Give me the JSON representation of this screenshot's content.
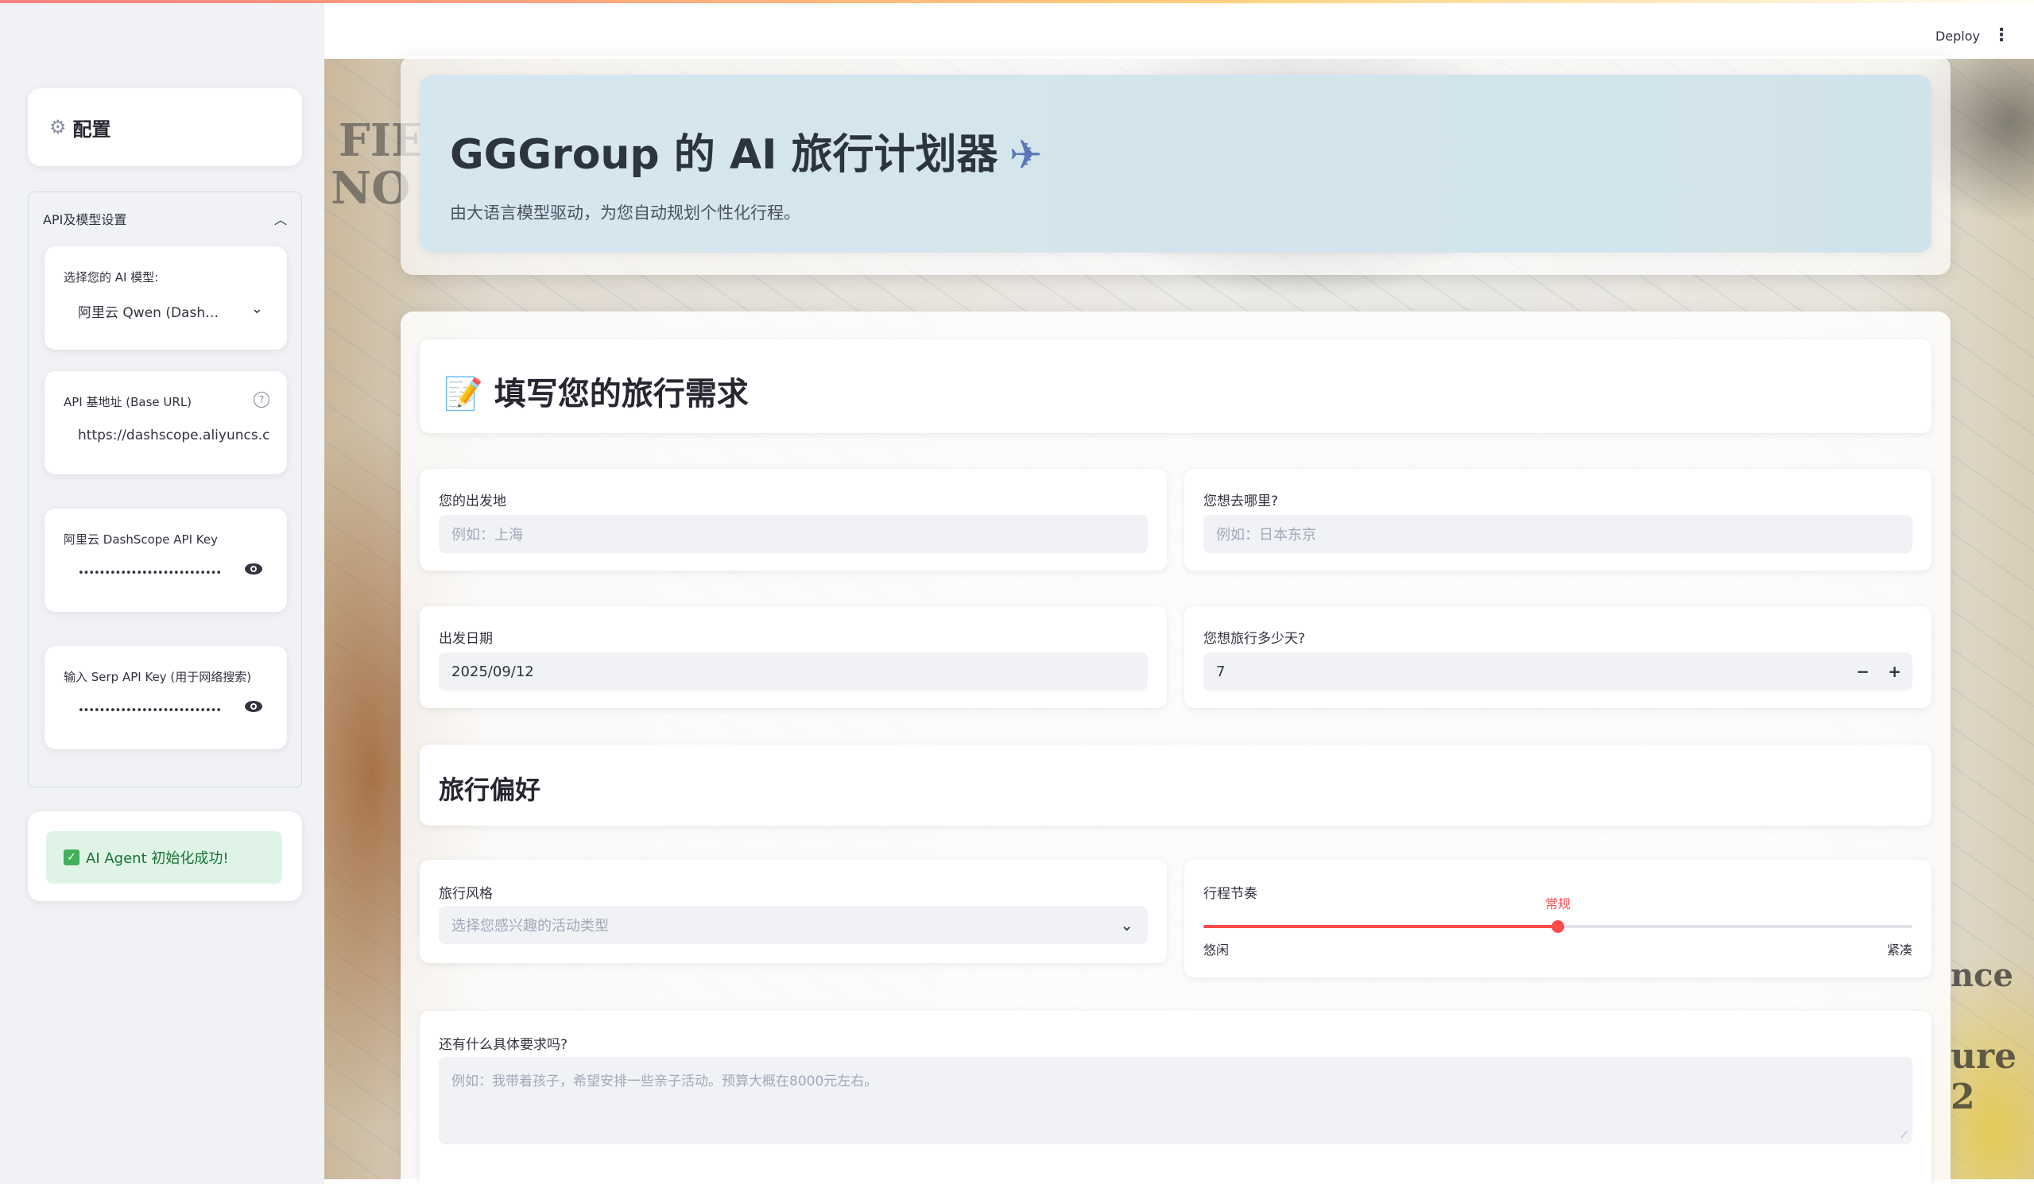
{
  "header": {
    "deploy_label": "Deploy",
    "menu_icon": "more-vertical-icon"
  },
  "sidebar": {
    "config_icon": "gear-icon",
    "config_title": "配置",
    "expander_label": "API及模型设置",
    "model_label": "选择您的 AI 模型:",
    "model_value": "阿里云 Qwen (Dash…",
    "base_url_label": "API 基地址 (Base URL)",
    "base_url_value": "https://dashscope.aliyuncs.co",
    "dashscope_key_label": "阿里云 DashScope API Key",
    "dashscope_key_value": "••••••••••••••••••••••••••••••••••",
    "serp_key_label": "输入 Serp API Key (用于网络搜索)",
    "serp_key_value": "••••••••••••••••••••••••••••••••••",
    "success_icon": "check-box-icon",
    "success_text": "AI Agent 初始化成功!"
  },
  "hero": {
    "title": "GGGroup 的 AI 旅行计划器",
    "plane_icon": "✈",
    "subtitle": "由大语言模型驱动，为您自动规划个性化行程。"
  },
  "form": {
    "section_icon": "📝",
    "section_title": "填写您的旅行需求",
    "origin_label": "您的出发地",
    "origin_placeholder": "例如：上海",
    "destination_label": "您想去哪里?",
    "destination_placeholder": "例如：日本东京",
    "date_label": "出发日期",
    "date_value": "2025/09/12",
    "days_label": "您想旅行多少天?",
    "days_value": "7",
    "minus_label": "−",
    "plus_label": "+",
    "pref_title": "旅行偏好",
    "style_label": "旅行风格",
    "style_placeholder": "选择您感兴趣的活动类型",
    "pace_label": "行程节奏",
    "pace_value": "常规",
    "pace_min": "悠闲",
    "pace_max": "紧凑",
    "pace_fraction": 0.5,
    "extra_label": "还有什么具体要求吗?",
    "extra_placeholder": "例如：我带着孩子，希望安排一些亲子活动。预算大概在8000元左右。"
  },
  "colors": {
    "accent": "#ff4b4b",
    "sidebar_bg": "#f0f2f6",
    "success_bg": "#dff4e6",
    "success_text": "#177233"
  }
}
